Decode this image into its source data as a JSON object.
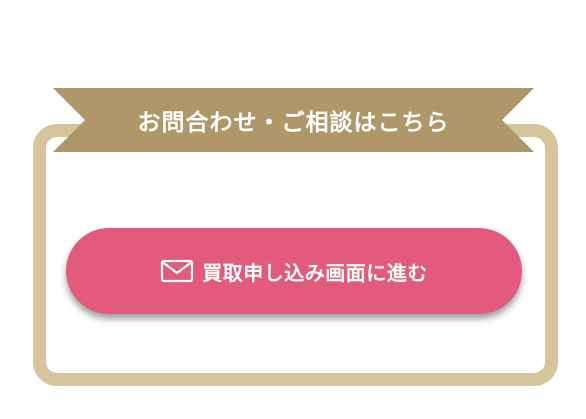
{
  "ribbon": {
    "label": "お問合わせ・ご相談はこちら",
    "color": "#b0976a"
  },
  "frame": {
    "color": "#d6c49d"
  },
  "cta": {
    "label": "買取申し込み画面に進む",
    "icon": "mail-icon",
    "color": "#e25a7c"
  }
}
